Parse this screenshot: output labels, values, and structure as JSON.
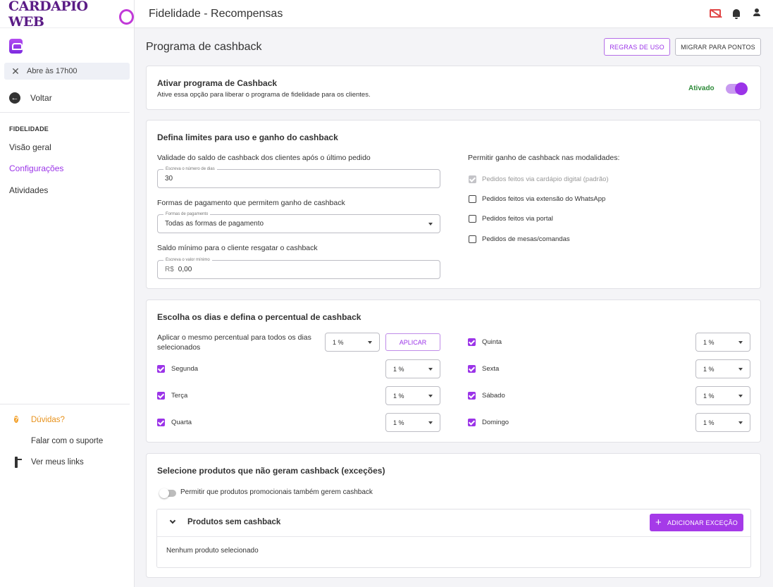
{
  "brand": {
    "logo_text": "CARDÁPIO WEB",
    "accent": "#9b34e8"
  },
  "sidebar": {
    "status": "Abre às 17h00",
    "back": "Voltar",
    "section": "FIDELIDADE",
    "items": [
      {
        "label": "Visão geral",
        "active": false
      },
      {
        "label": "Configurações",
        "active": true
      },
      {
        "label": "Atividades",
        "active": false
      }
    ],
    "footer": [
      {
        "label": "Dúvidas?",
        "icon": "help-icon"
      },
      {
        "label": "Falar com o suporte",
        "icon": "chat-icon"
      },
      {
        "label": "Ver meus links",
        "icon": "links-icon"
      }
    ]
  },
  "topbar": {
    "title": "Fidelidade - Recompensas"
  },
  "page": {
    "title": "Programa de cashback",
    "rules_button": "REGRAS DE USO",
    "migrate_button": "MIGRAR PARA PONTOS"
  },
  "activate": {
    "title": "Ativar programa de Cashback",
    "description": "Ative essa opção para liberar o programa de fidelidade para os clientes.",
    "status": "Ativado"
  },
  "limits": {
    "title": "Defina limites para uso e ganho do cashback",
    "validity_label": "Validade do saldo de cashback dos clientes após o último pedido",
    "validity_legend": "Escreva o número de dias",
    "validity_value": "30",
    "payment_label": "Formas de pagamento que permitem ganho de cashback",
    "payment_legend": "Formas de pagamento",
    "payment_value": "Todas as formas de pagamento",
    "minimum_label": "Saldo mínimo para o cliente resgatar o cashback",
    "minimum_legend": "Escreva o valor mínimo",
    "minimum_prefix": "R$",
    "minimum_value": "0,00",
    "modalities_label": "Permitir ganho de cashback nas modalidades:",
    "modalities": [
      {
        "label": "Pedidos feitos via cardápio digital (padrão)",
        "state": "disabled"
      },
      {
        "label": "Pedidos feitos via extensão do WhatsApp",
        "state": "unchecked"
      },
      {
        "label": "Pedidos feitos via portal",
        "state": "unchecked"
      },
      {
        "label": "Pedidos de mesas/comandas",
        "state": "unchecked"
      }
    ]
  },
  "days": {
    "title": "Escolha os dias e defina o percentual de cashback",
    "apply_all_label": "Aplicar o mesmo percentual para todos os dias selecionados",
    "apply_all_value": "1 %",
    "apply_button": "APLICAR",
    "left": [
      {
        "label": "Segunda",
        "value": "1 %"
      },
      {
        "label": "Terça",
        "value": "1 %"
      },
      {
        "label": "Quarta",
        "value": "1 %"
      }
    ],
    "right": [
      {
        "label": "Quinta",
        "value": "1 %"
      },
      {
        "label": "Sexta",
        "value": "1 %"
      },
      {
        "label": "Sábado",
        "value": "1 %"
      },
      {
        "label": "Domingo",
        "value": "1 %"
      }
    ]
  },
  "exceptions": {
    "title": "Selecione produtos que não geram cashback (exceções)",
    "promo_toggle_label": "Permitir que produtos promocionais também gerem cashback",
    "panel_title": "Produtos sem cashback",
    "add_button": "ADICIONAR EXCEÇÃO",
    "empty_text": "Nenhum produto selecionado"
  }
}
